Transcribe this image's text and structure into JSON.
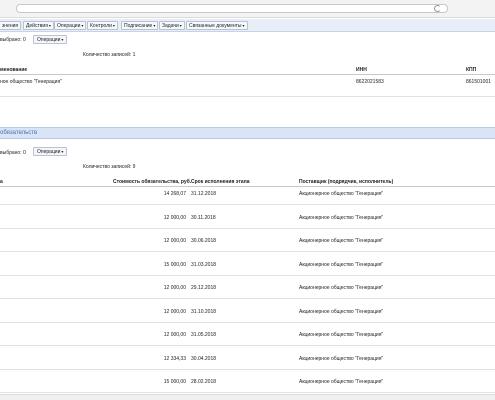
{
  "toolbar": {
    "items": [
      "знения",
      "Действия",
      "Операции",
      "Контроли",
      "Подписание",
      "Задачи",
      "Связанные документы"
    ]
  },
  "panel1": {
    "selected_label": "выбрано: 0",
    "ops_label": "Операции",
    "count_label": "Количество записей: 1",
    "headers": {
      "name": "менование",
      "inn": "ИНН",
      "kpp": "КПП"
    },
    "row": {
      "name": "ное общество \"Генерация\"",
      "inn": "8622021583",
      "kpp": "861501001"
    }
  },
  "section": {
    "title": "обязательств"
  },
  "panel2": {
    "selected_label": "выбрано: 0",
    "ops_label": "Операции",
    "count_label": "Количество записей: 9",
    "headers": {
      "name": "а",
      "cost": "Стоимость обязательства, руб.",
      "date": "Срок исполнения этапа",
      "supplier": "Поставщик (подрядчик, исполнитель)"
    },
    "rows": [
      {
        "cost": "14 268,07",
        "date": "31.12.2018",
        "supplier": "Акционерное общество \"Генерация\""
      },
      {
        "cost": "12 000,00",
        "date": "30.11.2018",
        "supplier": "Акционерное общество \"Генерация\""
      },
      {
        "cost": "12 000,00",
        "date": "30.06.2018",
        "supplier": "Акционерное общество \"Генерация\""
      },
      {
        "cost": "15 000,00",
        "date": "31.03.2018",
        "supplier": "Акционерное общество \"Генерация\""
      },
      {
        "cost": "12 000,00",
        "date": "29.12.2018",
        "supplier": "Акционерное общество \"Генерация\""
      },
      {
        "cost": "12 000,00",
        "date": "31.10.2018",
        "supplier": "Акционерное общество \"Генерация\""
      },
      {
        "cost": "12 000,00",
        "date": "31.05.2018",
        "supplier": "Акционерное общество \"Генерация\""
      },
      {
        "cost": "12 334,33",
        "date": "30.04.2018",
        "supplier": "Акционерное общество \"Генерация\""
      },
      {
        "cost": "15 000,00",
        "date": "28.02.2018",
        "supplier": "Акционерное общество \"Генерация\""
      }
    ]
  }
}
